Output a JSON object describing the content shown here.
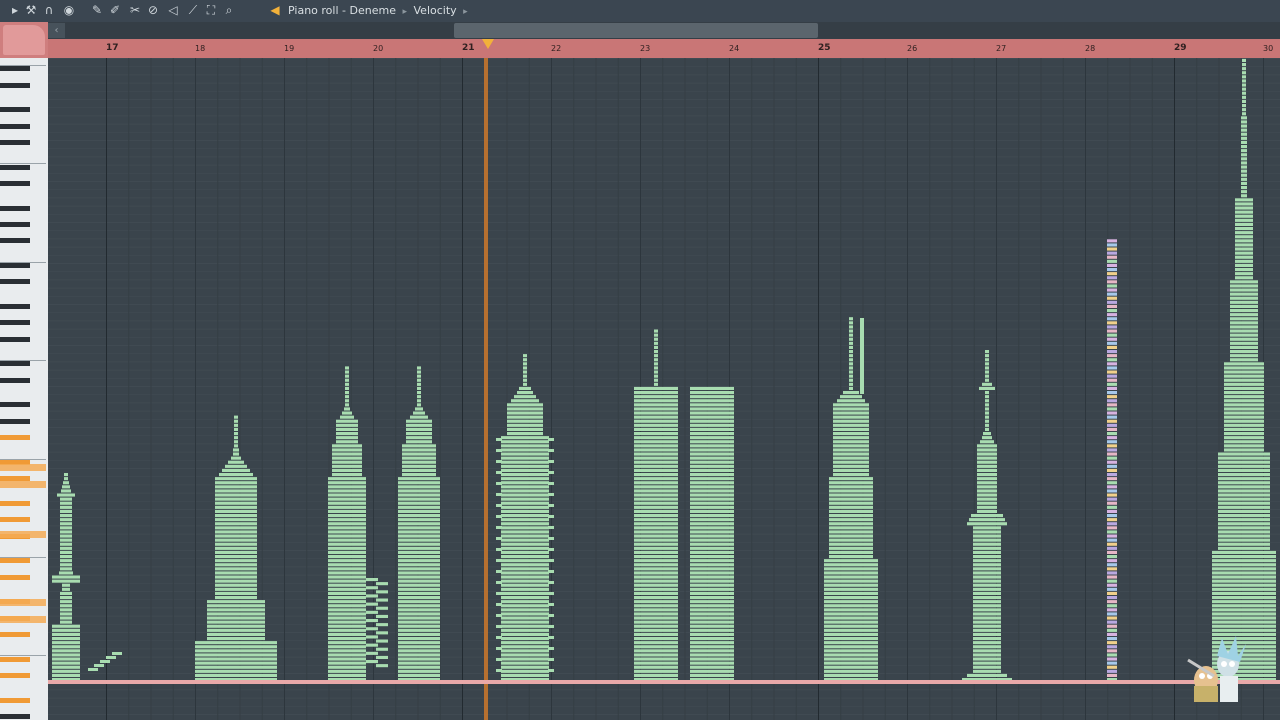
{
  "toolbar": {
    "title": {
      "window": "Piano roll",
      "separator": "-",
      "pattern": "Deneme",
      "arrow1": "▸",
      "target": "Velocity",
      "arrow2": "▸"
    },
    "icons": [
      {
        "name": "menu-arrow-icon",
        "glyph": "▸"
      },
      {
        "name": "wrench-icon",
        "glyph": "⚒"
      },
      {
        "name": "magnet-icon",
        "glyph": "∩"
      },
      {
        "name": "record-icon",
        "glyph": "◉"
      },
      {
        "name": "pencil-icon",
        "glyph": "✎"
      },
      {
        "name": "paint-icon",
        "glyph": "✐"
      },
      {
        "name": "delete-icon",
        "glyph": "✂"
      },
      {
        "name": "mute-icon",
        "glyph": "⊘"
      },
      {
        "name": "speaker-mute-icon",
        "glyph": "◁"
      },
      {
        "name": "slice-icon",
        "glyph": "⟋"
      },
      {
        "name": "select-icon",
        "glyph": "⛶"
      },
      {
        "name": "zoom-icon",
        "glyph": "⌕"
      },
      {
        "name": "playback-icon",
        "glyph": "◀"
      }
    ]
  },
  "ruler": {
    "bars": [
      "17",
      "18",
      "19",
      "20",
      "21",
      "22",
      "23",
      "24",
      "25",
      "26",
      "27",
      "28",
      "29",
      "30"
    ],
    "major_bars": [
      "17",
      "21",
      "25",
      "29"
    ]
  },
  "colors": {
    "note": "#a8dcb0",
    "note_dark": "#6fae7a",
    "grid_bg": "#3a444c",
    "ruler": "#c97676",
    "playhead": "#c4762e",
    "floor": "#e9a9a9"
  }
}
